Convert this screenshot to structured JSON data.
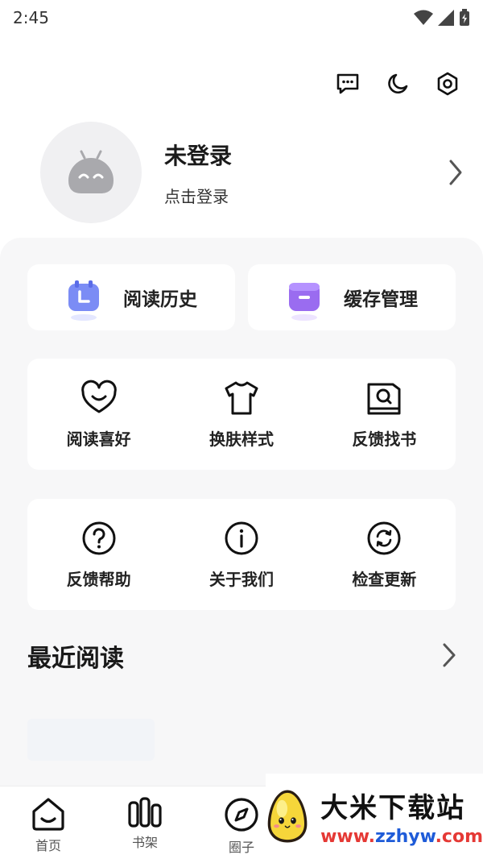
{
  "status": {
    "time": "2:45"
  },
  "toolbar": {
    "icons": [
      "message-icon",
      "moon-icon",
      "settings-icon"
    ]
  },
  "profile": {
    "name": "未登录",
    "subtitle": "点击登录"
  },
  "quick": [
    {
      "label": "阅读历史",
      "icon": "calendar-icon",
      "color": "#7b8cf5"
    },
    {
      "label": "缓存管理",
      "icon": "folder-icon",
      "color": "#9a6cf0"
    }
  ],
  "grid1": [
    {
      "label": "阅读喜好",
      "icon": "heart-smile-icon"
    },
    {
      "label": "换肤样式",
      "icon": "tshirt-icon"
    },
    {
      "label": "反馈找书",
      "icon": "book-search-icon"
    }
  ],
  "grid2": [
    {
      "label": "反馈帮助",
      "icon": "question-icon"
    },
    {
      "label": "关于我们",
      "icon": "info-icon"
    },
    {
      "label": "检查更新",
      "icon": "refresh-icon"
    }
  ],
  "recent": {
    "title": "最近阅读"
  },
  "tabs": [
    {
      "label": "首页",
      "icon": "home-icon"
    },
    {
      "label": "书架",
      "icon": "bookshelf-icon"
    },
    {
      "label": "圈子",
      "icon": "compass-icon"
    }
  ],
  "watermark": {
    "title": "大米下载站",
    "url_prefix": "www.",
    "url_mid": "zzhyw",
    "url_suffix": ".com"
  }
}
